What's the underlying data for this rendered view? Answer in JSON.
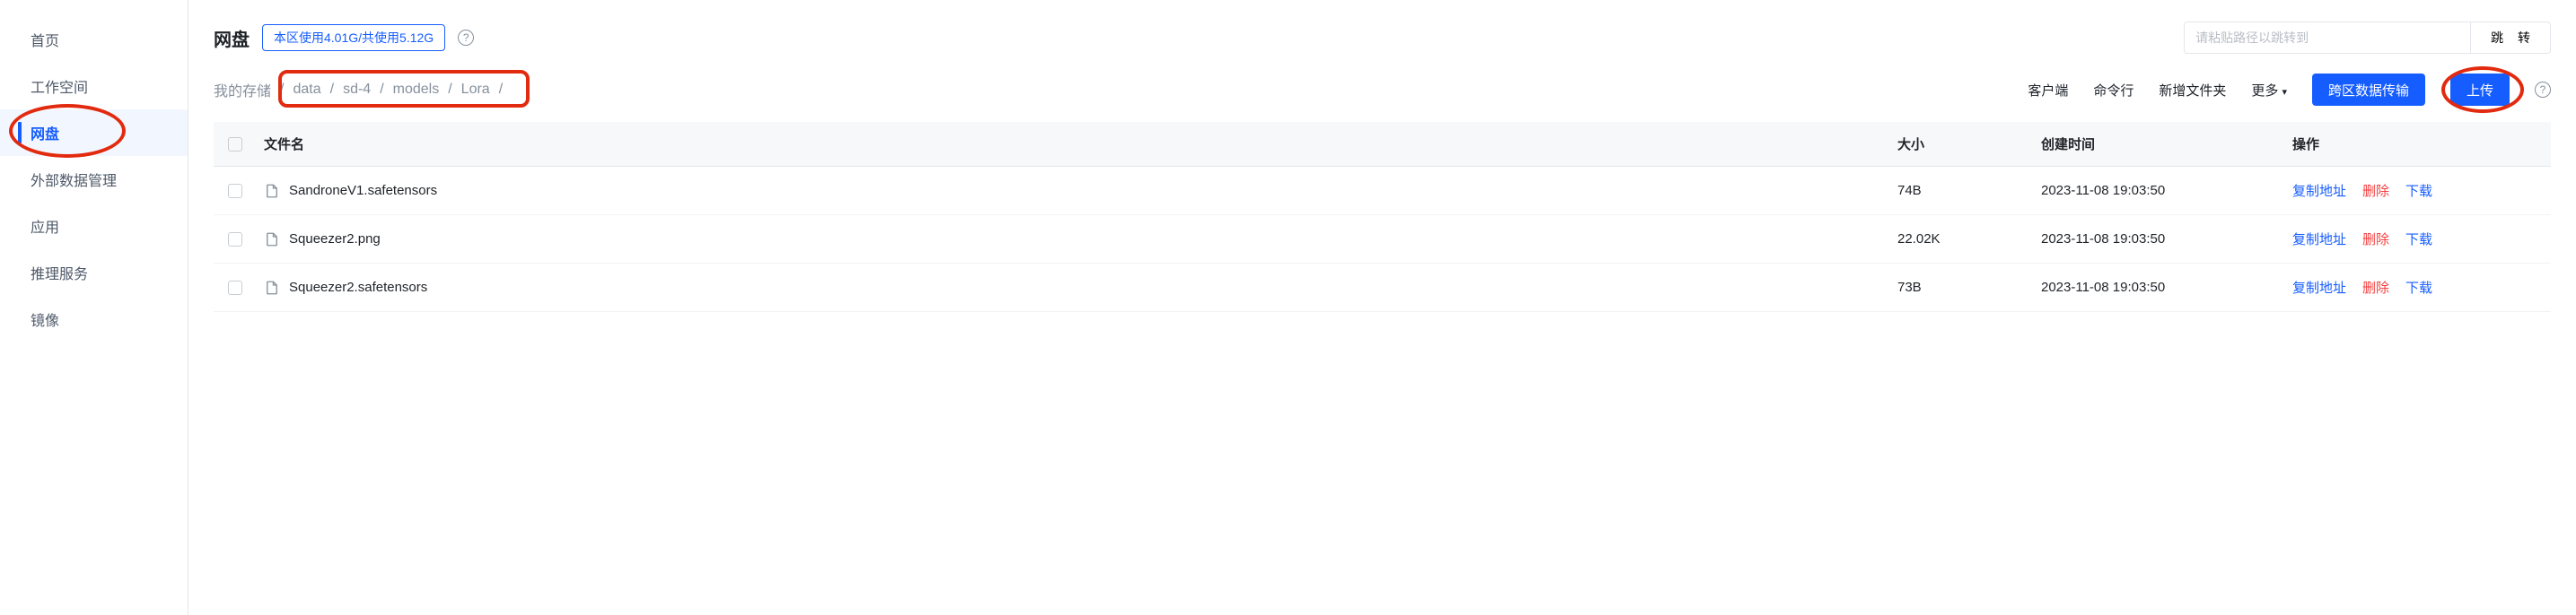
{
  "sidebar": {
    "items": [
      {
        "label": "首页",
        "active": false
      },
      {
        "label": "工作空间",
        "active": false
      },
      {
        "label": "网盘",
        "active": true
      },
      {
        "label": "外部数据管理",
        "active": false
      },
      {
        "label": "应用",
        "active": false
      },
      {
        "label": "推理服务",
        "active": false
      },
      {
        "label": "镜像",
        "active": false
      }
    ]
  },
  "header": {
    "title": "网盘",
    "usage_badge": "本区使用4.01G/共使用5.12G",
    "jump_placeholder": "请粘贴路径以跳转到",
    "jump_btn": "跳 转"
  },
  "breadcrumb": {
    "root": "我的存储",
    "segments": [
      "data",
      "sd-4",
      "models",
      "Lora"
    ]
  },
  "toolbar": {
    "client": "客户端",
    "cli": "命令行",
    "new_folder": "新增文件夹",
    "more": "更多",
    "transfer": "跨区数据传输",
    "upload": "上传"
  },
  "table": {
    "cols": {
      "name": "文件名",
      "size": "大小",
      "created": "创建时间",
      "ops": "操作"
    },
    "actions": {
      "copy": "复制地址",
      "del": "删除",
      "download": "下载"
    },
    "rows": [
      {
        "name": "SandroneV1.safetensors",
        "size": "74B",
        "created": "2023-11-08 19:03:50"
      },
      {
        "name": "Squeezer2.png",
        "size": "22.02K",
        "created": "2023-11-08 19:03:50"
      },
      {
        "name": "Squeezer2.safetensors",
        "size": "73B",
        "created": "2023-11-08 19:03:50"
      }
    ]
  }
}
